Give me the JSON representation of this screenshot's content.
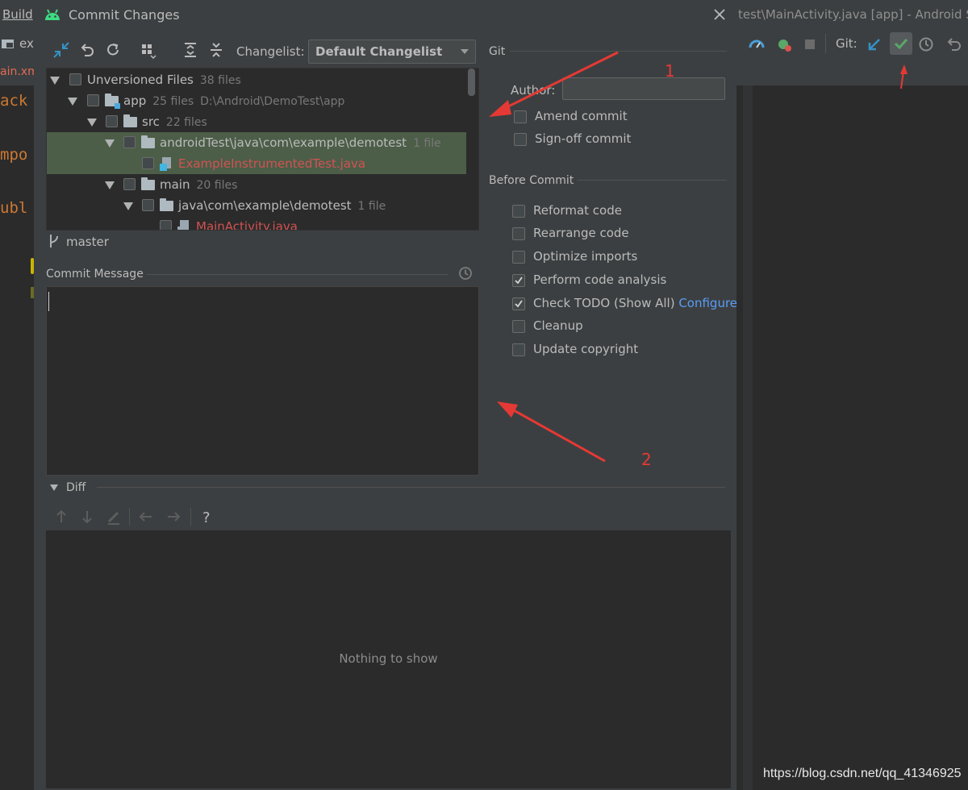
{
  "background": {
    "menu_build": "Build",
    "toolbar_left_text": "ex",
    "tab_left_text": "ain.xm",
    "code_fragments": [
      "ack",
      "mpo",
      "ubl"
    ],
    "window_title_fragment": "test\\MainActivity.java [app] - Android S",
    "git_label": "Git:"
  },
  "dialog": {
    "title": "Commit Changes",
    "changelist_label": "Changelist:",
    "changelist_value": "Default Changelist",
    "tree": [
      {
        "name": "Unversioned Files",
        "count": "38 files",
        "path": ""
      },
      {
        "name": "app",
        "count": "25 files",
        "path": "D:\\Android\\DemoTest\\app"
      },
      {
        "name": "src",
        "count": "22 files",
        "path": ""
      },
      {
        "name": "androidTest\\java\\com\\example\\demotest",
        "count": "1 file",
        "path": ""
      },
      {
        "name": "ExampleInstrumentedTest.java",
        "count": "",
        "path": ""
      },
      {
        "name": "main",
        "count": "20 files",
        "path": ""
      },
      {
        "name": "java\\com\\example\\demotest",
        "count": "1 file",
        "path": ""
      },
      {
        "name": "MainActivity.java",
        "count": "",
        "path": ""
      }
    ],
    "branch": "master",
    "commit_message_label": "Commit Message",
    "commit_message_value": "",
    "git_section": "Git",
    "author_label": "Author:",
    "author_value": "",
    "git_options": [
      {
        "label": "Amend commit",
        "checked": false
      },
      {
        "label": "Sign-off commit",
        "checked": false
      }
    ],
    "before_commit_section": "Before Commit",
    "before_commit_options": [
      {
        "label": "Reformat code",
        "checked": false
      },
      {
        "label": "Rearrange code",
        "checked": false
      },
      {
        "label": "Optimize imports",
        "checked": false
      },
      {
        "label": "Perform code analysis",
        "checked": true
      },
      {
        "label": "Check TODO (Show All)",
        "checked": true,
        "link": "Configure"
      },
      {
        "label": "Cleanup",
        "checked": false
      },
      {
        "label": "Update copyright",
        "checked": false
      }
    ],
    "diff_label": "Diff",
    "diff_empty": "Nothing to show"
  },
  "annotations": {
    "one": "1",
    "two": "2"
  },
  "watermark": "https://blog.csdn.net/qq_41346925",
  "colors": {
    "accent_blue": "#589df6",
    "annotation_red": "#e53935",
    "selected_row": "#4c5e48",
    "file_red": "#d25252"
  }
}
